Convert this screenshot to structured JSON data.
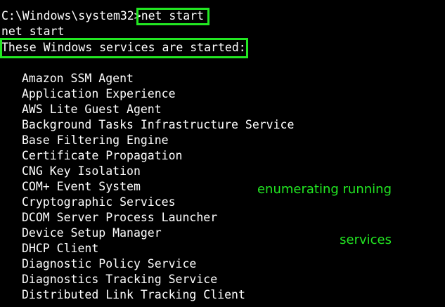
{
  "terminal": {
    "prompt": "C:\\Windows\\system32>",
    "command": "net start",
    "echo": "net start",
    "header": "These Windows services are started:",
    "services": [
      "Amazon SSM Agent",
      "Application Experience",
      "AWS Lite Guest Agent",
      "Background Tasks Infrastructure Service",
      "Base Filtering Engine",
      "Certificate Propagation",
      "CNG Key Isolation",
      "COM+ Event System",
      "Cryptographic Services",
      "DCOM Server Process Launcher",
      "Device Setup Manager",
      "DHCP Client",
      "Diagnostic Policy Service",
      "Diagnostics Tracking Service",
      "Distributed Link Tracking Client"
    ]
  },
  "annotation": {
    "line1": "enumerating running",
    "line2": "services",
    "color": "#22e722"
  },
  "colors": {
    "background": "#000000",
    "text": "#ffffff",
    "highlight": "#22e722"
  }
}
